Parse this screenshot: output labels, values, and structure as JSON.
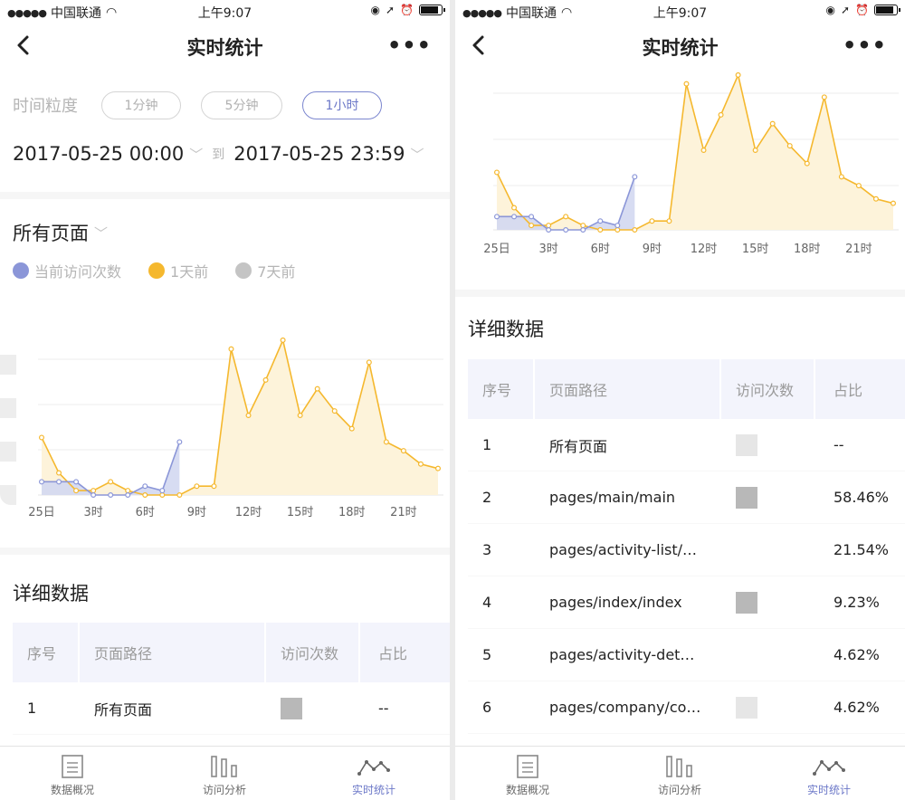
{
  "status_bar": {
    "carrier": "中国联通",
    "time": "上午9:07"
  },
  "nav": {
    "title": "实时统计",
    "more": "•••"
  },
  "granularity": {
    "label": "时间粒度",
    "options": [
      "1分钟",
      "5分钟",
      "1小时"
    ],
    "selected": "1小时"
  },
  "date_range": {
    "start": "2017-05-25  00:00",
    "to": "到",
    "end": "2017-05-25  23:59"
  },
  "page_filter": {
    "selected": "所有页面"
  },
  "legend": [
    {
      "label": "当前访问次数",
      "color": "#8b96d8"
    },
    {
      "label": "1天前",
      "color": "#f5b82e"
    },
    {
      "label": "7天前",
      "color": "#c4c4c4"
    }
  ],
  "chart_data": {
    "type": "area",
    "x_tick_labels": [
      "25日",
      "3时",
      "6时",
      "9时",
      "12时",
      "15时",
      "18时",
      "21时"
    ],
    "x": [
      0,
      1,
      2,
      3,
      4,
      5,
      6,
      7,
      8,
      9,
      10,
      11,
      12,
      13,
      14,
      15,
      16,
      17,
      18,
      19,
      20,
      21,
      22,
      23
    ],
    "ylim": [
      0,
      36
    ],
    "grid": true,
    "series": [
      {
        "name": "当前访问次数",
        "color": "#8b96d8",
        "values": [
          3,
          3,
          3,
          0,
          0,
          0,
          2,
          1,
          12
        ]
      },
      {
        "name": "1天前",
        "color": "#f5b82e",
        "values": [
          13,
          5,
          1,
          1,
          3,
          1,
          0,
          0,
          0,
          2,
          2,
          33,
          18,
          26,
          35,
          18,
          24,
          19,
          15,
          30,
          12,
          10,
          7,
          6
        ]
      }
    ]
  },
  "details": {
    "title": "详细数据",
    "headers": [
      "序号",
      "页面路径",
      "访问次数",
      "占比"
    ],
    "rows": [
      {
        "no": "1",
        "path": "所有页面",
        "bar": "light",
        "ratio": "--"
      },
      {
        "no": "2",
        "path": "pages/main/main",
        "bar": "dark",
        "ratio": "58.46%"
      },
      {
        "no": "3",
        "path": "pages/activity-list/…",
        "bar": "none",
        "ratio": "21.54%"
      },
      {
        "no": "4",
        "path": "pages/index/index",
        "bar": "dark",
        "ratio": "9.23%"
      },
      {
        "no": "5",
        "path": "pages/activity-det…",
        "bar": "none",
        "ratio": "4.62%"
      },
      {
        "no": "6",
        "path": "pages/company/co…",
        "bar": "light",
        "ratio": "4.62%"
      }
    ],
    "left_rows": [
      {
        "no": "1",
        "path": "所有页面",
        "bar": "dark",
        "ratio": "--"
      }
    ]
  },
  "tabs": [
    {
      "label": "数据概况",
      "icon": "document-icon"
    },
    {
      "label": "访问分析",
      "icon": "bars-icon"
    },
    {
      "label": "实时统计",
      "icon": "line-trend-icon",
      "active": true
    }
  ]
}
